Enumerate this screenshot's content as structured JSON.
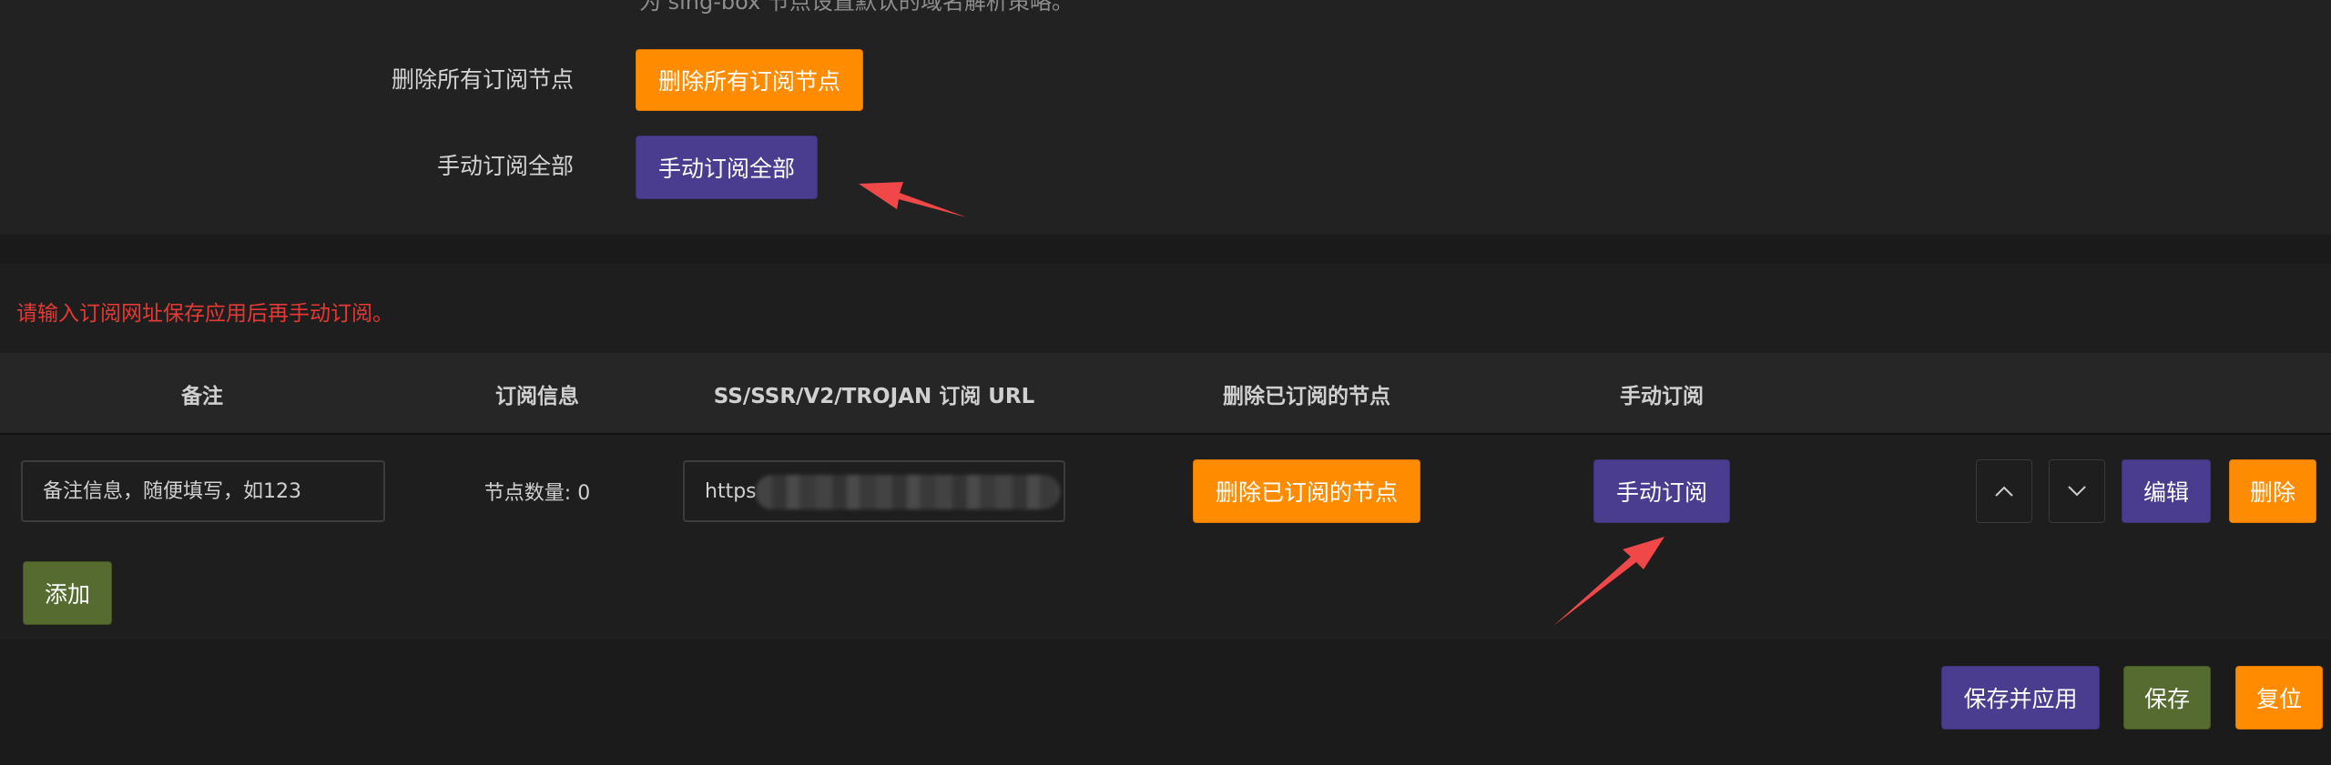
{
  "top_section": {
    "cut_text": "为 sing-box 节点设置默认的域名解析策略。",
    "delete_all_label": "删除所有订阅节点",
    "delete_all_button": "删除所有订阅节点",
    "manual_all_label": "手动订阅全部",
    "manual_all_button": "手动订阅全部"
  },
  "hint": "请输入订阅网址保存应用后再手动订阅。",
  "table": {
    "headers": [
      "备注",
      "订阅信息",
      "SS/SSR/V2/TROJAN 订阅 URL",
      "删除已订阅的节点",
      "手动订阅"
    ],
    "rows": [
      {
        "remark_placeholder": "备注信息，随便填写，如123",
        "info": "节点数量: 0",
        "url": "https",
        "delete_button": "删除已订阅的节点",
        "manual_button": "手动订阅",
        "edit_button": "编辑",
        "remove_button": "删除"
      }
    ],
    "add_button": "添加"
  },
  "footer": {
    "save_apply": "保存并应用",
    "save": "保存",
    "reset": "复位"
  },
  "icons": {
    "up": "chevron-up-icon",
    "down": "chevron-down-icon",
    "annotation_arrow": "red-arrow-icon"
  },
  "colors": {
    "orange": "#ff8c00",
    "purple": "#4a3d8f",
    "green": "#566b2f",
    "hint_red": "#e53935",
    "arrow_red": "#f04848"
  }
}
